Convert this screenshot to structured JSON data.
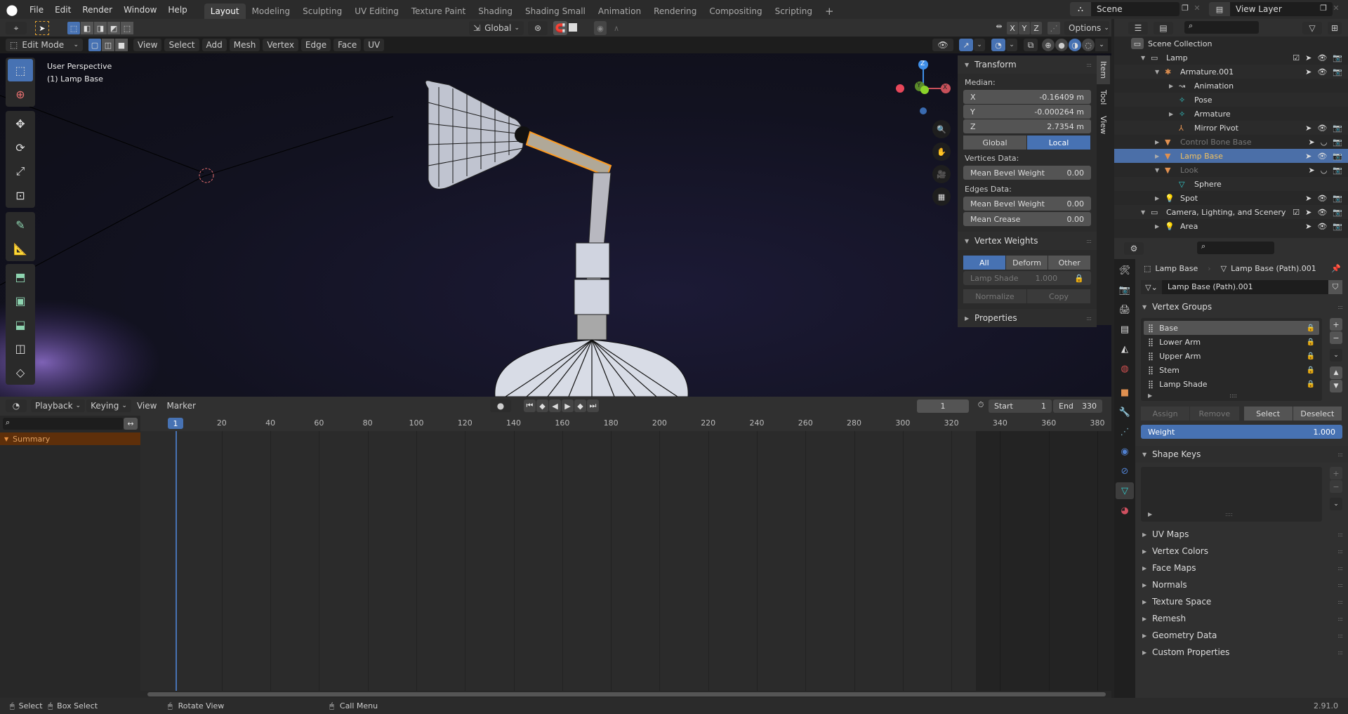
{
  "menubar": {
    "items": [
      "File",
      "Edit",
      "Render",
      "Window",
      "Help"
    ],
    "workspaces": [
      "Layout",
      "Modeling",
      "Sculpting",
      "UV Editing",
      "Texture Paint",
      "Shading",
      "Shading Small",
      "Animation",
      "Rendering",
      "Compositing",
      "Scripting"
    ],
    "active_workspace": "Layout",
    "add_tab": "+",
    "scene": "Scene",
    "view_layer": "View Layer"
  },
  "tool_header": {
    "transform_orientation": "Global",
    "axes": [
      "X",
      "Y",
      "Z"
    ],
    "options_label": "Options"
  },
  "viewport_header": {
    "mode": "Edit Mode",
    "menus": [
      "View",
      "Select",
      "Add",
      "Mesh",
      "Vertex",
      "Edge",
      "Face",
      "UV"
    ]
  },
  "viewport": {
    "perspective_label": "User Perspective",
    "object_label": "(1) Lamp Base",
    "gizmo": {
      "x": "X",
      "y": "Y",
      "z": "Z"
    },
    "tools": [
      "select-box",
      "cursor",
      "move",
      "rotate",
      "scale",
      "transform",
      "annotate",
      "measure",
      "extrude",
      "inset",
      "bevel",
      "loop-cut",
      "knife"
    ],
    "nav_icons": [
      "zoom",
      "pan",
      "camera",
      "ortho-grid"
    ],
    "colors": {
      "x_axis": "#e8475a",
      "y_axis": "#8bd32a",
      "z_axis": "#3f8fe8",
      "selection": "#ff9a1e"
    }
  },
  "npanel": {
    "tabs": [
      "Item",
      "Tool",
      "View"
    ],
    "transform": {
      "title": "Transform",
      "median_label": "Median:",
      "fields": [
        {
          "label": "X",
          "value": "-0.16409 m"
        },
        {
          "label": "Y",
          "value": "-0.000264 m"
        },
        {
          "label": "Z",
          "value": "2.7354 m"
        }
      ],
      "space_options": [
        "Global",
        "Local"
      ],
      "space_active": "Local",
      "vertices_data_label": "Vertices Data:",
      "vertices_mean_bevel": {
        "label": "Mean Bevel Weight",
        "value": "0.00"
      },
      "edges_data_label": "Edges Data:",
      "edges_mean_bevel": {
        "label": "Mean Bevel Weight",
        "value": "0.00"
      },
      "edges_mean_crease": {
        "label": "Mean Crease",
        "value": "0.00"
      }
    },
    "vertex_weights": {
      "title": "Vertex Weights",
      "filters": [
        "All",
        "Deform",
        "Other"
      ],
      "filter_active": "All",
      "group": "Lamp Shade",
      "group_value": "1.000",
      "normalize": "Normalize",
      "copy": "Copy"
    },
    "properties_title": "Properties"
  },
  "outliner": {
    "root": "Scene Collection",
    "rows": [
      {
        "label": "Lamp",
        "indent": 1,
        "expand": "down",
        "kind": "collection",
        "checkbox": true,
        "vis": true
      },
      {
        "label": "Armature.001",
        "indent": 2,
        "expand": "down",
        "kind": "armature",
        "vis": true
      },
      {
        "label": "Animation",
        "indent": 3,
        "expand": "right",
        "kind": "action",
        "vis": false
      },
      {
        "label": "Pose",
        "indent": 3,
        "expand": "",
        "kind": "pose",
        "vis": false
      },
      {
        "label": "Armature",
        "indent": 3,
        "expand": "right",
        "kind": "armature-data",
        "vis": false
      },
      {
        "label": "Mirror Pivot",
        "indent": 3,
        "expand": "",
        "kind": "empty",
        "vis": true
      },
      {
        "label": "Control Bone Base",
        "indent": 2,
        "expand": "right",
        "kind": "mesh",
        "vis": true,
        "dim": true
      },
      {
        "label": "Lamp Base",
        "indent": 2,
        "expand": "right",
        "kind": "mesh",
        "vis": true,
        "selected": true
      },
      {
        "label": "Look",
        "indent": 2,
        "expand": "down",
        "kind": "mesh",
        "vis": true,
        "dim": true
      },
      {
        "label": "Sphere",
        "indent": 3,
        "expand": "",
        "kind": "mesh-data",
        "vis": false
      },
      {
        "label": "Spot",
        "indent": 2,
        "expand": "right",
        "kind": "light",
        "vis": true
      },
      {
        "label": "Camera, Lighting, and Scenery",
        "indent": 1,
        "expand": "down",
        "kind": "collection",
        "checkbox": true,
        "vis": true
      },
      {
        "label": "Area",
        "indent": 2,
        "expand": "right",
        "kind": "light",
        "vis": true
      }
    ]
  },
  "properties": {
    "breadcrumb_object": "Lamp Base",
    "breadcrumb_data": "Lamp Base (Path).001",
    "mesh_name": "Lamp Base (Path).001",
    "vertex_groups_title": "Vertex Groups",
    "vertex_groups": [
      "Base",
      "Lower Arm",
      "Upper Arm",
      "Stem",
      "Lamp Shade"
    ],
    "active_group": "Base",
    "assign": "Assign",
    "remove": "Remove",
    "select": "Select",
    "deselect": "Deselect",
    "weight_label": "Weight",
    "weight_value": "1.000",
    "shape_keys_title": "Shape Keys",
    "collapsed_sections": [
      "UV Maps",
      "Vertex Colors",
      "Face Maps",
      "Normals",
      "Texture Space",
      "Remesh",
      "Geometry Data",
      "Custom Properties"
    ]
  },
  "timeline": {
    "menus": [
      "Playback",
      "Keying",
      "View",
      "Marker"
    ],
    "current_frame": "1",
    "start_label": "Start",
    "start": "1",
    "end_label": "End",
    "end": "330",
    "ruler": [
      "20",
      "40",
      "60",
      "80",
      "100",
      "120",
      "140",
      "160",
      "180",
      "200",
      "220",
      "240",
      "260",
      "280",
      "300",
      "320",
      "340",
      "360",
      "380"
    ],
    "playhead": "1",
    "summary": "Summary"
  },
  "statusbar": {
    "items": [
      "Select",
      "Box Select",
      "Rotate View",
      "Call Menu"
    ],
    "version": "2.91.0"
  }
}
